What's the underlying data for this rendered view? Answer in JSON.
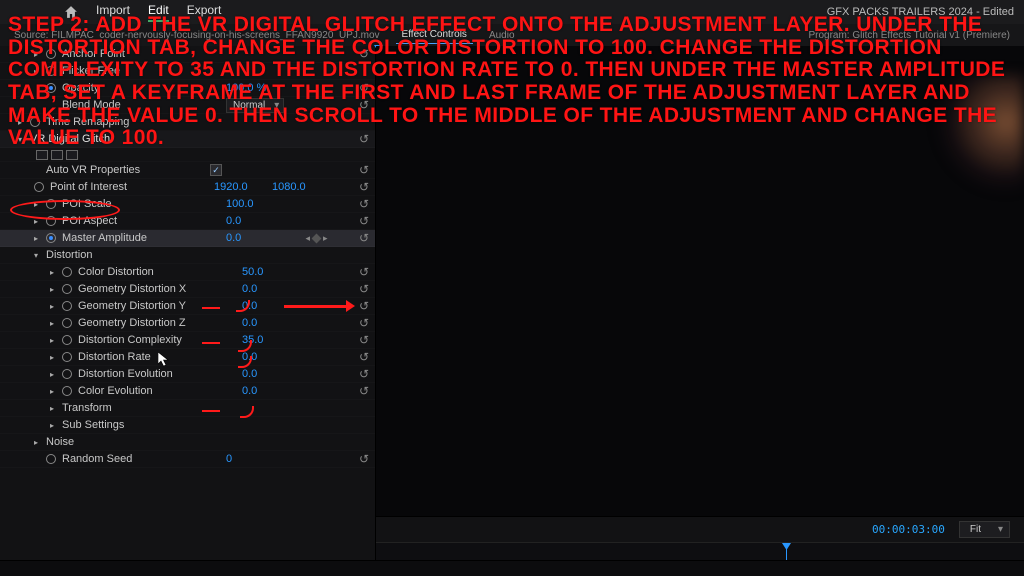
{
  "window": {
    "title_right": "GFX PACKS TRAILERS 2024 - Edited",
    "menu": {
      "import": "Import",
      "edit": "Edit",
      "export": "Export"
    }
  },
  "panel_tabs": {
    "source": "Source: FILMPAC_coder-nervously-focusing-on-his-screens_FFAN9920_UPJ.mov",
    "effect_controls": "Effect Controls",
    "audio": "Audio",
    "program": "Program: Glitch Effects Tutorial v1 (Premiere)"
  },
  "effects": {
    "anchor_point": "Anchor Point",
    "flicker": "Flicker Free",
    "opacity": {
      "label": "Opacity",
      "value": "100.0 %"
    },
    "blend_mode": {
      "label": "Blend Mode",
      "value": "Normal"
    },
    "time_remap": "Time Remapping",
    "vr_glitch": "VR Digital Glitch",
    "auto_vr": {
      "label": "Auto VR Properties"
    },
    "poi": {
      "label": "Point of Interest",
      "x": "1920.0",
      "y": "1080.0"
    },
    "poi_scale": {
      "label": "POI Scale",
      "value": "100.0"
    },
    "poi_aspect": {
      "label": "POI Aspect",
      "value": "0.0"
    },
    "master_amp": {
      "label": "Master Amplitude",
      "value": "0.0"
    },
    "distortion_group": "Distortion",
    "color_dist": {
      "label": "Color Distortion",
      "value": "50.0"
    },
    "geom_x": {
      "label": "Geometry Distortion X",
      "value": "0.0"
    },
    "geom_y": {
      "label": "Geometry Distortion Y",
      "value": "0.0"
    },
    "geom_z": {
      "label": "Geometry Distortion Z",
      "value": "0.0"
    },
    "dist_comp": {
      "label": "Distortion Complexity",
      "value": "35.0"
    },
    "dist_rate": {
      "label": "Distortion Rate",
      "value": "0.0"
    },
    "dist_evo": {
      "label": "Distortion Evolution",
      "value": "0.0"
    },
    "color_evo": {
      "label": "Color Evolution",
      "value": "0.0"
    },
    "transform": "Transform",
    "sub": "Sub Settings",
    "noise": "Noise",
    "seed": {
      "label": "Random Seed",
      "value": "0"
    }
  },
  "preview": {
    "timecode": "00:00:03:00",
    "fit": "Fit"
  },
  "overlay": "Step 2: Add the VR digital glitch effect onto the adjustment layer. Under the distortion tab, change the color distortion to 100. Change the distortion complexity to 35 and the distortion rate to 0. Then under the master amplitude tab, set a keyframe at the first and last frame of the adjustment layer and make the value 0. Then scroll to the middle of the adjustment and change the value to 100."
}
